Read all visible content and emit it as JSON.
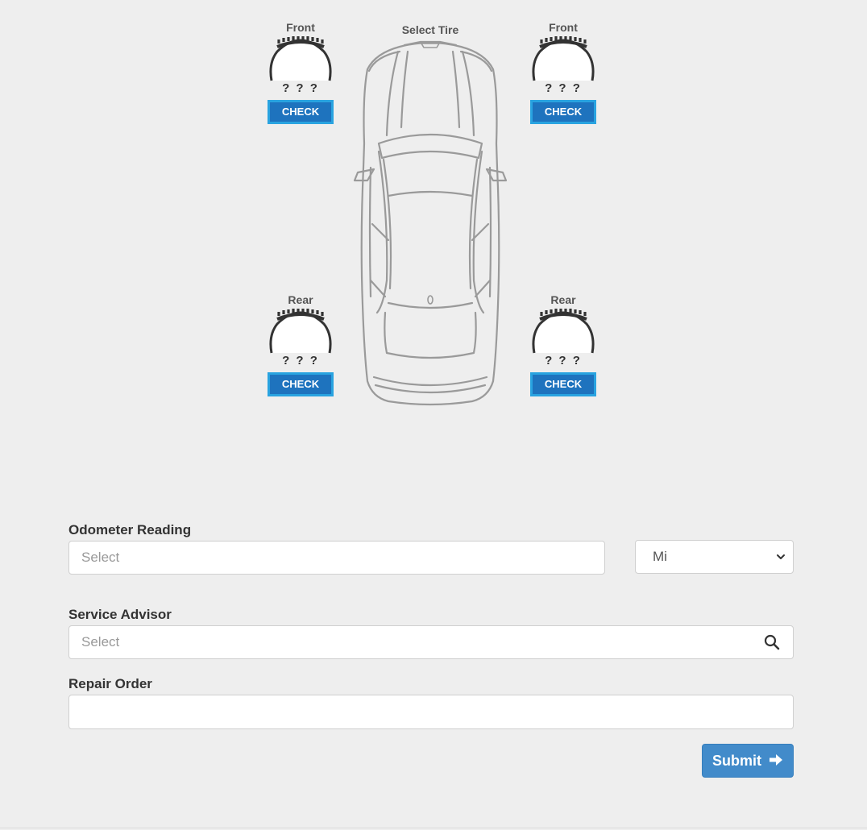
{
  "tire_selector": {
    "title": "Select Tire",
    "tires": [
      {
        "label": "Front",
        "value": "? ? ?",
        "button": "CHECK"
      },
      {
        "label": "Front",
        "value": "? ? ?",
        "button": "CHECK"
      },
      {
        "label": "Rear",
        "value": "? ? ?",
        "button": "CHECK"
      },
      {
        "label": "Rear",
        "value": "? ? ?",
        "button": "CHECK"
      }
    ]
  },
  "form": {
    "odometer": {
      "label": "Odometer Reading",
      "placeholder": "Select",
      "unit_selected": "Mi"
    },
    "service_advisor": {
      "label": "Service Advisor",
      "placeholder": "Select"
    },
    "repair_order": {
      "label": "Repair Order",
      "value": ""
    },
    "submit_label": "Submit"
  },
  "icons": {
    "search": "search-icon",
    "dropdown": "chevron-down-icon",
    "submit": "arrow-right-icon"
  },
  "colors": {
    "check_button": "#1e73be",
    "check_button_border": "#29a3e0",
    "submit_button": "#428bca",
    "background": "#eeeeee"
  }
}
